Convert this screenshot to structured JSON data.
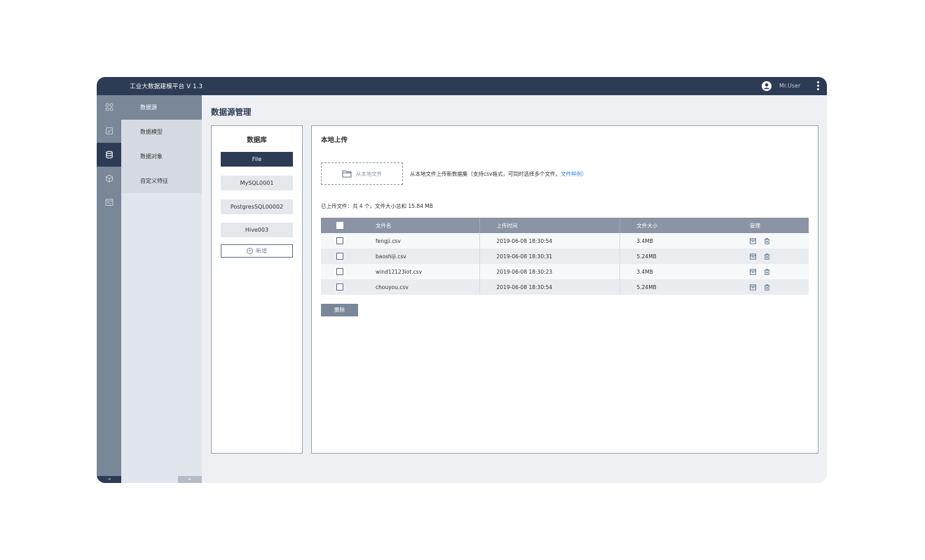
{
  "app": {
    "title": "工业大数据建模平台   V 1.3",
    "user_name": "Mr.User"
  },
  "rail": {
    "icons": [
      "grid-icon",
      "checklist-icon",
      "database-icon",
      "cube-icon",
      "terminal-icon"
    ],
    "active_index": 2,
    "expand_label": "⇥"
  },
  "subnav": {
    "items": [
      {
        "label": "数据源",
        "active": true
      },
      {
        "label": "数据模型",
        "active": false
      },
      {
        "label": "数据对象",
        "active": false
      },
      {
        "label": "自定义特征",
        "active": false
      }
    ],
    "collapse_label": "⇤"
  },
  "page": {
    "title": "数据源管理"
  },
  "database_panel": {
    "title": "数据库",
    "sources": [
      {
        "label": "File",
        "active": true
      },
      {
        "label": "MySQL0001",
        "active": false
      },
      {
        "label": "PostgresSQL00002",
        "active": false
      },
      {
        "label": "Hive003",
        "active": false
      }
    ],
    "add_label": "新增"
  },
  "upload_panel": {
    "title": "本地上传",
    "upload_button": "从本地文件",
    "hint_text": "从本地文件上传新数据集（支持csv格式，可同时选择多个文件。",
    "hint_link": "文件样例",
    "hint_close": "）",
    "summary": "已上传文件：共 4 个，文件大小总和 15.84 MB",
    "table": {
      "headers": [
        "文件名",
        "上传时间",
        "文件大小",
        "管理"
      ],
      "rows": [
        {
          "name": " fengji.csv",
          "time": "2019-06-08  18:30:54",
          "size": "3.4MB"
        },
        {
          "name": "baoshiji.csv",
          "time": "2019-06-08  18:30:31",
          "size": "5.24MB"
        },
        {
          "name": "wind12123iot.csv",
          "time": "2019-06-08  18:30:23",
          "size": "3.4MB"
        },
        {
          "name": "chouyou.csv",
          "time": "2019-06-08  18:30:54",
          "size": "5.24MB"
        }
      ]
    },
    "delete_button": "删除"
  },
  "colors": {
    "primary_dark": "#2d3b55",
    "rail_gray": "#7a8799",
    "table_header": "#8a94a4",
    "link_blue": "#2f80ed"
  }
}
